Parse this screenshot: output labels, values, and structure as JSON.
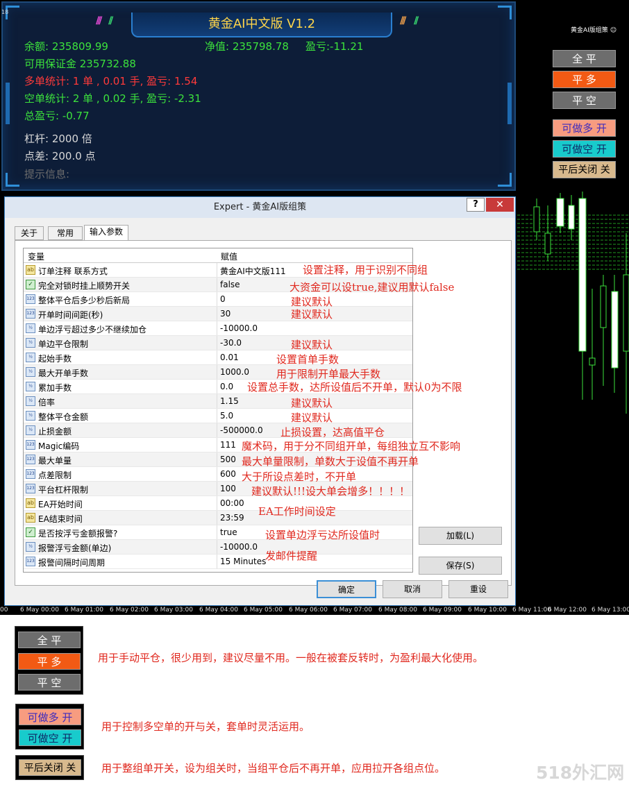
{
  "hud": {
    "title": "黄金AI中文版 V1.2",
    "balance": "余额: 235809.99",
    "equity": "净值: 235798.78",
    "pnl": "盈亏:-11.21",
    "free_margin": "可用保证金 235732.88",
    "long_stats": "多单统计: 1 单 , 0.01 手, 盈亏: 1.54",
    "short_stats": "空单统计: 2 单 , 0.02 手, 盈亏: -2.31",
    "total_pnl": "总盈亏: -0.77",
    "leverage": "杠杆: 2000 倍",
    "spread": "点差: 200.0 点",
    "message": "提示信息:",
    "corner_num": "18"
  },
  "side_panel": {
    "mini_title": "黄金AI版组策",
    "btn_close_all": "全 平",
    "btn_close_long": "平 多",
    "btn_close_short": "平 空",
    "btn_allow_long": "可做多 开",
    "btn_allow_short": "可做空 开",
    "btn_close_after": "平后关闭 关"
  },
  "dialog": {
    "title": "Expert - 黄金AI版组策",
    "help": "?",
    "close": "✕",
    "tabs": [
      "关于",
      "常用",
      "输入参数"
    ],
    "col_var": "变量",
    "col_val": "赋值",
    "rows": [
      {
        "icon": "ab",
        "name": "订单注释 联系方式",
        "value": "黄金AI中文版111"
      },
      {
        "icon": "bool",
        "name": "完全对锁时挂上顺势开关",
        "value": "false"
      },
      {
        "icon": "123",
        "name": "整体平仓后多少秒后新局",
        "value": "0"
      },
      {
        "icon": "123",
        "name": "开单时间间距(秒)",
        "value": "30"
      },
      {
        "icon": "v2",
        "name": "单边浮亏超过多少不继续加仓",
        "value": "-10000.0"
      },
      {
        "icon": "v2",
        "name": "单边平仓限制",
        "value": "-30.0"
      },
      {
        "icon": "v2",
        "name": "起始手数",
        "value": "0.01"
      },
      {
        "icon": "v2",
        "name": "最大开单手数",
        "value": "1000.0"
      },
      {
        "icon": "v2",
        "name": "累加手数",
        "value": "0.0"
      },
      {
        "icon": "v2",
        "name": "倍率",
        "value": "1.15"
      },
      {
        "icon": "v2",
        "name": "整体平仓金额",
        "value": "5.0"
      },
      {
        "icon": "v2",
        "name": "止损金额",
        "value": "-500000.0"
      },
      {
        "icon": "123",
        "name": "Magic编码",
        "value": "111"
      },
      {
        "icon": "123",
        "name": "最大单量",
        "value": "500"
      },
      {
        "icon": "123",
        "name": "点差限制",
        "value": "600"
      },
      {
        "icon": "123",
        "name": "平台杠杆限制",
        "value": "100"
      },
      {
        "icon": "ab",
        "name": "EA开始时间",
        "value": "00:00"
      },
      {
        "icon": "ab",
        "name": "EA结束时间",
        "value": "23:59"
      },
      {
        "icon": "bool",
        "name": "是否按浮亏金额报警?",
        "value": "true"
      },
      {
        "icon": "v2",
        "name": "报警浮亏金额(单边)",
        "value": "-10000.0"
      },
      {
        "icon": "123",
        "name": "报警间隔时间周期",
        "value": "15 Minutes"
      }
    ],
    "btn_load": "加载(L)",
    "btn_save": "保存(S)",
    "btn_ok": "确定",
    "btn_cancel": "取消",
    "btn_reset": "重设"
  },
  "notes": [
    "设置注释，用于识别不同组",
    "大资金可以设true,建议用默认false",
    "建议默认",
    "建议默认",
    "建议默认",
    "设置首单手数",
    "用于限制开单最大手数",
    "设置总手数，达所设值后不开单，默认0为不限",
    "建议默认",
    "建议默认",
    "止损设置，达高值平仓",
    "魔术码，用于分不同组开单，每组独立互不影响",
    "最大单量限制，单数大于设值不再开单",
    "大于所设点差时，不开单",
    "建议默认!!!设大单会增多！！！！",
    "EA工作时间设定",
    "设置单边浮亏达所设值时",
    "发邮件提醒"
  ],
  "axis_labels": [
    "00",
    "6 May 00:00",
    "6 May 01:00",
    "6 May 02:00",
    "6 May 03:00",
    "6 May 04:00",
    "6 May 05:00",
    "6 May 06:00",
    "6 May 07:00",
    "6 May 08:00",
    "6 May 09:00",
    "6 May 10:00",
    "6 May 11:00",
    "6 May 12:00",
    "6 May 13:00"
  ],
  "legend": {
    "close_all": "全 平",
    "close_long": "平 多",
    "close_short": "平 空",
    "close_note": "用于手动平仓，很少用到，建议尽量不用。一般在被套反转时，为盈利最大化使用。",
    "allow_long": "可做多 开",
    "allow_short": "可做空 开",
    "allow_note": "用于控制多空单的开与关，套单时灵活运用。",
    "close_after": "平后关闭 关",
    "close_after_note": "用于整组单开关，设为组关时，当组平仓后不再开单，应用拉开各组点位。"
  },
  "watermark": "518外汇网",
  "colors": {
    "green": "#3ce23c",
    "red": "#ff3a3a",
    "gold": "#ffd54a",
    "note_red": "#e0281e",
    "chart_bg": "#000000",
    "hud_bg": "#0d1d38"
  }
}
